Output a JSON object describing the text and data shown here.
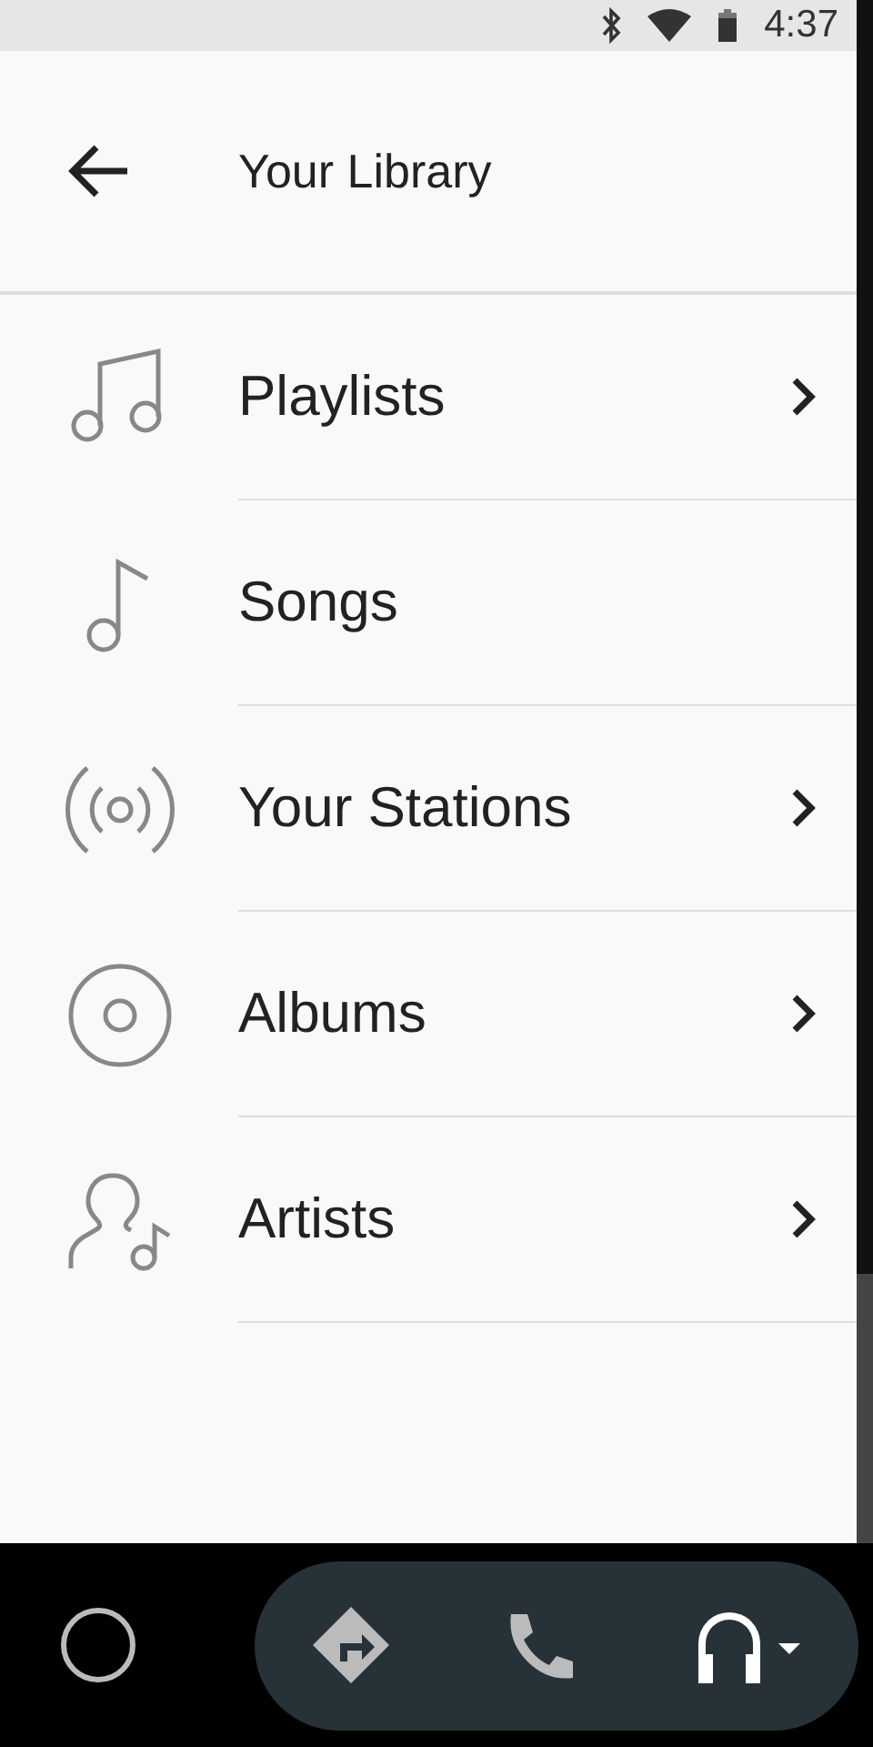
{
  "status_bar": {
    "time": "4:37"
  },
  "header": {
    "title": "Your Library"
  },
  "items": [
    {
      "label": "Playlists",
      "kind": "playlist",
      "chevron": true
    },
    {
      "label": "Songs",
      "kind": "song",
      "chevron": false
    },
    {
      "label": "Your Stations",
      "kind": "station",
      "chevron": true
    },
    {
      "label": "Albums",
      "kind": "album",
      "chevron": true
    },
    {
      "label": "Artists",
      "kind": "artist",
      "chevron": true
    }
  ]
}
